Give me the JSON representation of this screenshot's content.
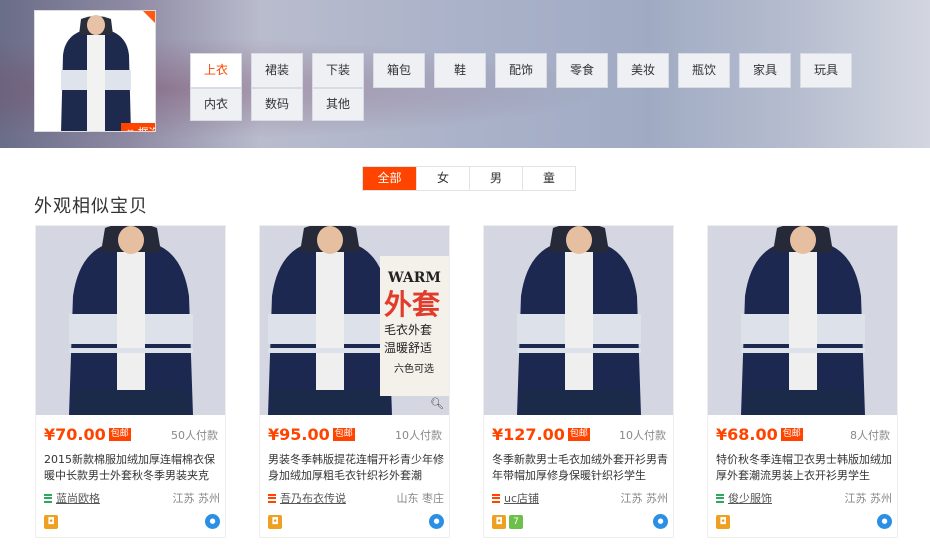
{
  "query_image": {
    "select_subject_label": "框选主体",
    "crop_icon": "crop-icon"
  },
  "categories_row1": [
    "上衣",
    "裙装",
    "下装",
    "箱包",
    "鞋",
    "配饰",
    "零食",
    "美妆",
    "瓶饮",
    "家具",
    "玩具"
  ],
  "categories_row2": [
    "内衣",
    "数码",
    "其他"
  ],
  "active_category": "上衣",
  "filter_tabs": [
    "全部",
    "女",
    "男",
    "童"
  ],
  "active_filter": "全部",
  "section_title": "外观相似宝贝",
  "products": [
    {
      "price": "¥70.00",
      "mail_tag": "包邮",
      "sold": "50人付款",
      "title": "2015新款棉服加绒加厚连帽棉衣保暖中长款男士外套秋冬季男装夹克",
      "shop": "蓝尚欧格",
      "shop_icon_color": "#2bab5a",
      "location": "江苏 苏州",
      "badges": [
        {
          "icon": "shield-icon",
          "color": "#f0a020",
          "glyph": "◘"
        }
      ],
      "has_zoom": false
    },
    {
      "price": "¥95.00",
      "mail_tag": "包邮",
      "sold": "10人付款",
      "title": "男装冬季韩版提花连帽开衫青少年修身加绒加厚粗毛衣针织衫外套潮",
      "shop": "吾乃布衣传说",
      "shop_icon_color": "#ff4400",
      "location": "山东 枣庄",
      "badges": [
        {
          "icon": "shield-icon",
          "color": "#f0a020",
          "glyph": "◘"
        }
      ],
      "has_zoom": true,
      "banner": {
        "line1": "WARM",
        "line2": "外套",
        "line3": "毛衣外套",
        "line4": "温暖舒适",
        "line5": "六色可选"
      }
    },
    {
      "price": "¥127.00",
      "mail_tag": "包邮",
      "sold": "10人付款",
      "title": "冬季新款男士毛衣加绒外套开衫男青年带帽加厚修身保暖针织衫学生",
      "shop": "uc店铺",
      "shop_icon_color": "#ff4400",
      "location": "江苏 苏州",
      "badges": [
        {
          "icon": "shield-icon",
          "color": "#f0a020",
          "glyph": "◘"
        },
        {
          "icon": "seven-day-icon",
          "color": "#6cc04a",
          "glyph": "7"
        }
      ],
      "has_zoom": false
    },
    {
      "price": "¥68.00",
      "mail_tag": "包邮",
      "sold": "8人付款",
      "title": "特价秋冬季连帽卫衣男士韩版加绒加厚外套潮流男装上衣开衫男学生",
      "shop": "俊少服饰",
      "shop_icon_color": "#2bab5a",
      "location": "江苏 苏州",
      "badges": [
        {
          "icon": "shield-icon",
          "color": "#f0a020",
          "glyph": "◘"
        }
      ],
      "has_zoom": false
    }
  ],
  "colors": {
    "accent": "#ff4400",
    "wangwang": "#2a8fe5"
  }
}
